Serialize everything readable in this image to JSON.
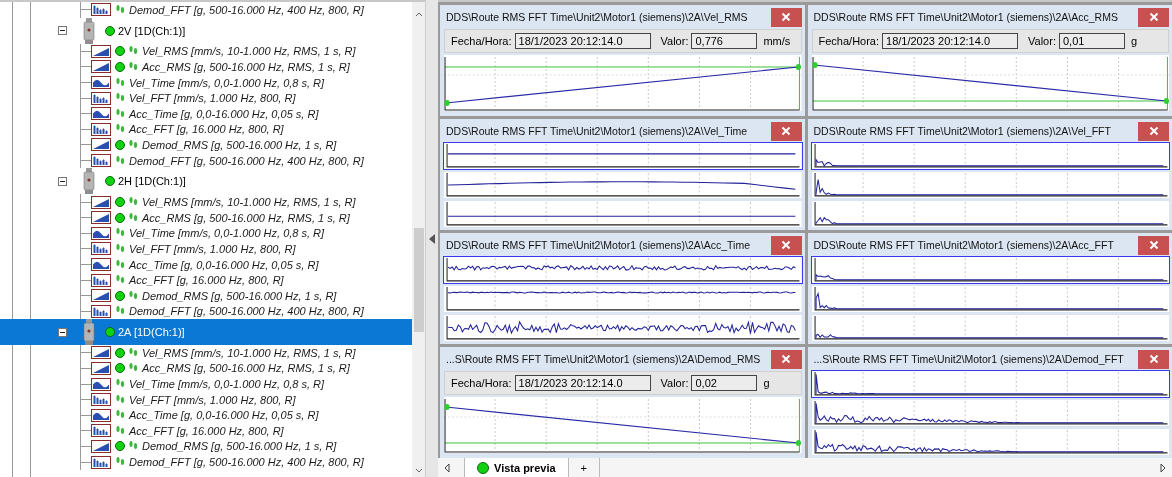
{
  "tree": {
    "leading_items": [
      {
        "kind": "spectrum",
        "dot": false,
        "label": "Demod_FFT [g, 500-16.000 Hz, 400 Hz, 800, R]"
      }
    ],
    "sensors": [
      {
        "label": "2V [1D(Ch:1)]",
        "expanded": true,
        "selected": false,
        "children": [
          {
            "kind": "trend",
            "dot": true,
            "label": "Vel_RMS [mm/s, 10-1.000 Hz, RMS, 1 s, R]"
          },
          {
            "kind": "trend",
            "dot": true,
            "label": "Acc_RMS [g, 500-16.000 Hz, RMS, 1 s, R]"
          },
          {
            "kind": "waveform",
            "dot": false,
            "label": "Vel_Time [mm/s, 0,0-1.000 Hz, 0,8 s, R]"
          },
          {
            "kind": "spectrum",
            "dot": false,
            "label": "Vel_FFT [mm/s, 1.000 Hz, 800, R]"
          },
          {
            "kind": "waveform",
            "dot": false,
            "label": "Acc_Time [g, 0,0-16.000 Hz, 0,05 s, R]"
          },
          {
            "kind": "spectrum",
            "dot": false,
            "label": "Acc_FFT [g, 16.000 Hz, 800, R]"
          },
          {
            "kind": "trend",
            "dot": true,
            "label": "Demod_RMS [g, 500-16.000 Hz, 1 s, R]"
          },
          {
            "kind": "spectrum",
            "dot": false,
            "label": "Demod_FFT [g, 500-16.000 Hz, 400 Hz, 800, R]"
          }
        ]
      },
      {
        "label": "2H [1D(Ch:1)]",
        "expanded": true,
        "selected": false,
        "children": [
          {
            "kind": "trend",
            "dot": true,
            "label": "Vel_RMS [mm/s, 10-1.000 Hz, RMS, 1 s, R]"
          },
          {
            "kind": "trend",
            "dot": true,
            "label": "Acc_RMS [g, 500-16.000 Hz, RMS, 1 s, R]"
          },
          {
            "kind": "waveform",
            "dot": false,
            "label": "Vel_Time [mm/s, 0,0-1.000 Hz, 0,8 s, R]"
          },
          {
            "kind": "spectrum",
            "dot": false,
            "label": "Vel_FFT [mm/s, 1.000 Hz, 800, R]"
          },
          {
            "kind": "waveform",
            "dot": false,
            "label": "Acc_Time [g, 0,0-16.000 Hz, 0,05 s, R]"
          },
          {
            "kind": "spectrum",
            "dot": false,
            "label": "Acc_FFT [g, 16.000 Hz, 800, R]"
          },
          {
            "kind": "trend",
            "dot": true,
            "label": "Demod_RMS [g, 500-16.000 Hz, 1 s, R]"
          },
          {
            "kind": "spectrum",
            "dot": false,
            "label": "Demod_FFT [g, 500-16.000 Hz, 400 Hz, 800, R]"
          }
        ]
      },
      {
        "label": "2A [1D(Ch:1)]",
        "expanded": true,
        "selected": true,
        "children": [
          {
            "kind": "trend",
            "dot": true,
            "label": "Vel_RMS [mm/s, 10-1.000 Hz, RMS, 1 s, R]"
          },
          {
            "kind": "trend",
            "dot": true,
            "label": "Acc_RMS [g, 500-16.000 Hz, RMS, 1 s, R]"
          },
          {
            "kind": "waveform",
            "dot": false,
            "label": "Vel_Time [mm/s, 0,0-1.000 Hz, 0,8 s, R]"
          },
          {
            "kind": "spectrum",
            "dot": false,
            "label": "Vel_FFT [mm/s, 1.000 Hz, 800, R]"
          },
          {
            "kind": "waveform",
            "dot": false,
            "label": "Acc_Time [g, 0,0-16.000 Hz, 0,05 s, R]"
          },
          {
            "kind": "spectrum",
            "dot": false,
            "label": "Acc_FFT [g, 16.000 Hz, 800, R]"
          },
          {
            "kind": "trend",
            "dot": true,
            "label": "Demod_RMS [g, 500-16.000 Hz, 1 s, R]"
          },
          {
            "kind": "spectrum",
            "dot": false,
            "label": "Demod_FFT [g, 500-16.000 Hz, 400 Hz, 800, R]"
          }
        ]
      }
    ]
  },
  "panels": [
    {
      "kind": "rising-trend",
      "title": "DDS\\Route RMS FFT Time\\Unit2\\Motor1 (siemens)\\2A\\Vel_RMS",
      "info": {
        "date_label": "Fecha/Hora:",
        "date": "18/1/2023 20:12:14.0",
        "value_label": "Valor:",
        "value": "0,776",
        "unit": "mm/s"
      }
    },
    {
      "kind": "falling-trend",
      "title": "DDS\\Route RMS FFT Time\\Unit2\\Motor1 (siemens)\\2A\\Acc_RMS",
      "info": {
        "date_label": "Fecha/Hora:",
        "date": "18/1/2023 20:12:14.0",
        "value_label": "Valor:",
        "value": "0,01",
        "unit": "g"
      }
    },
    {
      "kind": "waveform",
      "title": "DDS\\Route RMS FFT Time\\Unit2\\Motor1 (siemens)\\2A\\Vel_Time"
    },
    {
      "kind": "spectrum",
      "title": "DDS\\Route RMS FFT Time\\Unit2\\Motor1 (siemens)\\2A\\Vel_FFT"
    },
    {
      "kind": "waveform",
      "title": "DDS\\Route RMS FFT Time\\Unit2\\Motor1 (siemens)\\2A\\Acc_Time"
    },
    {
      "kind": "spectrum",
      "title": "DDS\\Route RMS FFT Time\\Unit2\\Motor1 (siemens)\\2A\\Acc_FFT"
    },
    {
      "kind": "falling-trend",
      "title": "...S\\Route RMS FFT Time\\Unit2\\Motor1 (siemens)\\2A\\Demod_RMS",
      "info": {
        "date_label": "Fecha/Hora:",
        "date": "18/1/2023 20:12:14.0",
        "value_label": "Valor:",
        "value": "0,02",
        "unit": "g"
      }
    },
    {
      "kind": "spectrum",
      "title": "...S\\Route RMS FFT Time\\Unit2\\Motor1 (siemens)\\2A\\Demod_FFT"
    }
  ],
  "tabs": [
    {
      "label": "Vista previa",
      "selected": true,
      "dot": true
    },
    {
      "label": "+",
      "selected": false,
      "dot": false
    }
  ]
}
